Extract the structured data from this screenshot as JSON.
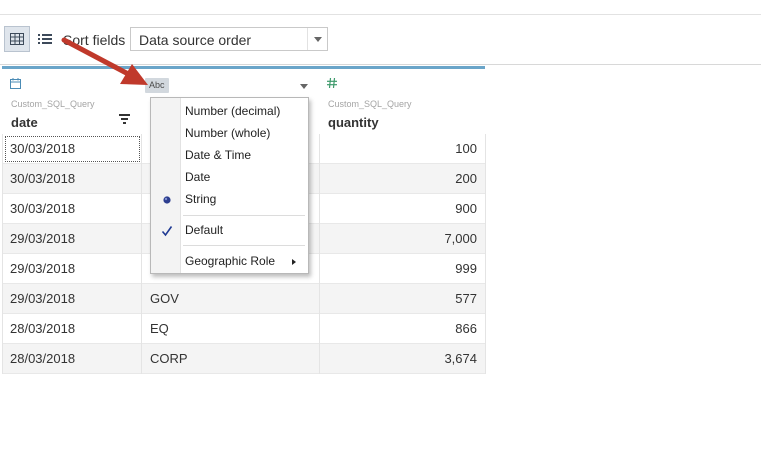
{
  "toolbar": {
    "sort_label": "Sort fields",
    "sort_value": "Data source order",
    "grid_view_icon": "grid-view-icon",
    "list_view_icon": "list-view-icon"
  },
  "columns": [
    {
      "type_icon": "calendar-icon",
      "source": "Custom_SQL_Query",
      "name": "date"
    },
    {
      "type_badge": "Abc",
      "source": "",
      "name": ""
    },
    {
      "type_icon": "number-icon",
      "source": "Custom_SQL_Query",
      "name": "quantity"
    }
  ],
  "rows": [
    {
      "date": "30/03/2018",
      "type": "",
      "quantity": "100"
    },
    {
      "date": "30/03/2018",
      "type": "",
      "quantity": "200"
    },
    {
      "date": "30/03/2018",
      "type": "",
      "quantity": "900"
    },
    {
      "date": "29/03/2018",
      "type": "",
      "quantity": "7,000"
    },
    {
      "date": "29/03/2018",
      "type": "",
      "quantity": "999"
    },
    {
      "date": "29/03/2018",
      "type": "GOV",
      "quantity": "577"
    },
    {
      "date": "28/03/2018",
      "type": "EQ",
      "quantity": "866"
    },
    {
      "date": "28/03/2018",
      "type": "CORP",
      "quantity": "3,674"
    }
  ],
  "menu": {
    "items": [
      {
        "label": "Number (decimal)",
        "mark": ""
      },
      {
        "label": "Number (whole)",
        "mark": ""
      },
      {
        "label": "Date & Time",
        "mark": ""
      },
      {
        "label": "Date",
        "mark": ""
      },
      {
        "label": "String",
        "mark": "radio"
      },
      {
        "label": "Default",
        "mark": "check"
      },
      {
        "label": "Geographic Role",
        "mark": "",
        "submenu": true
      }
    ]
  },
  "colors": {
    "header_accent": "#6aa5c9",
    "arrow": "#c0392b",
    "check": "#1f3a93",
    "menu_gutter": "#f3f3f3"
  }
}
